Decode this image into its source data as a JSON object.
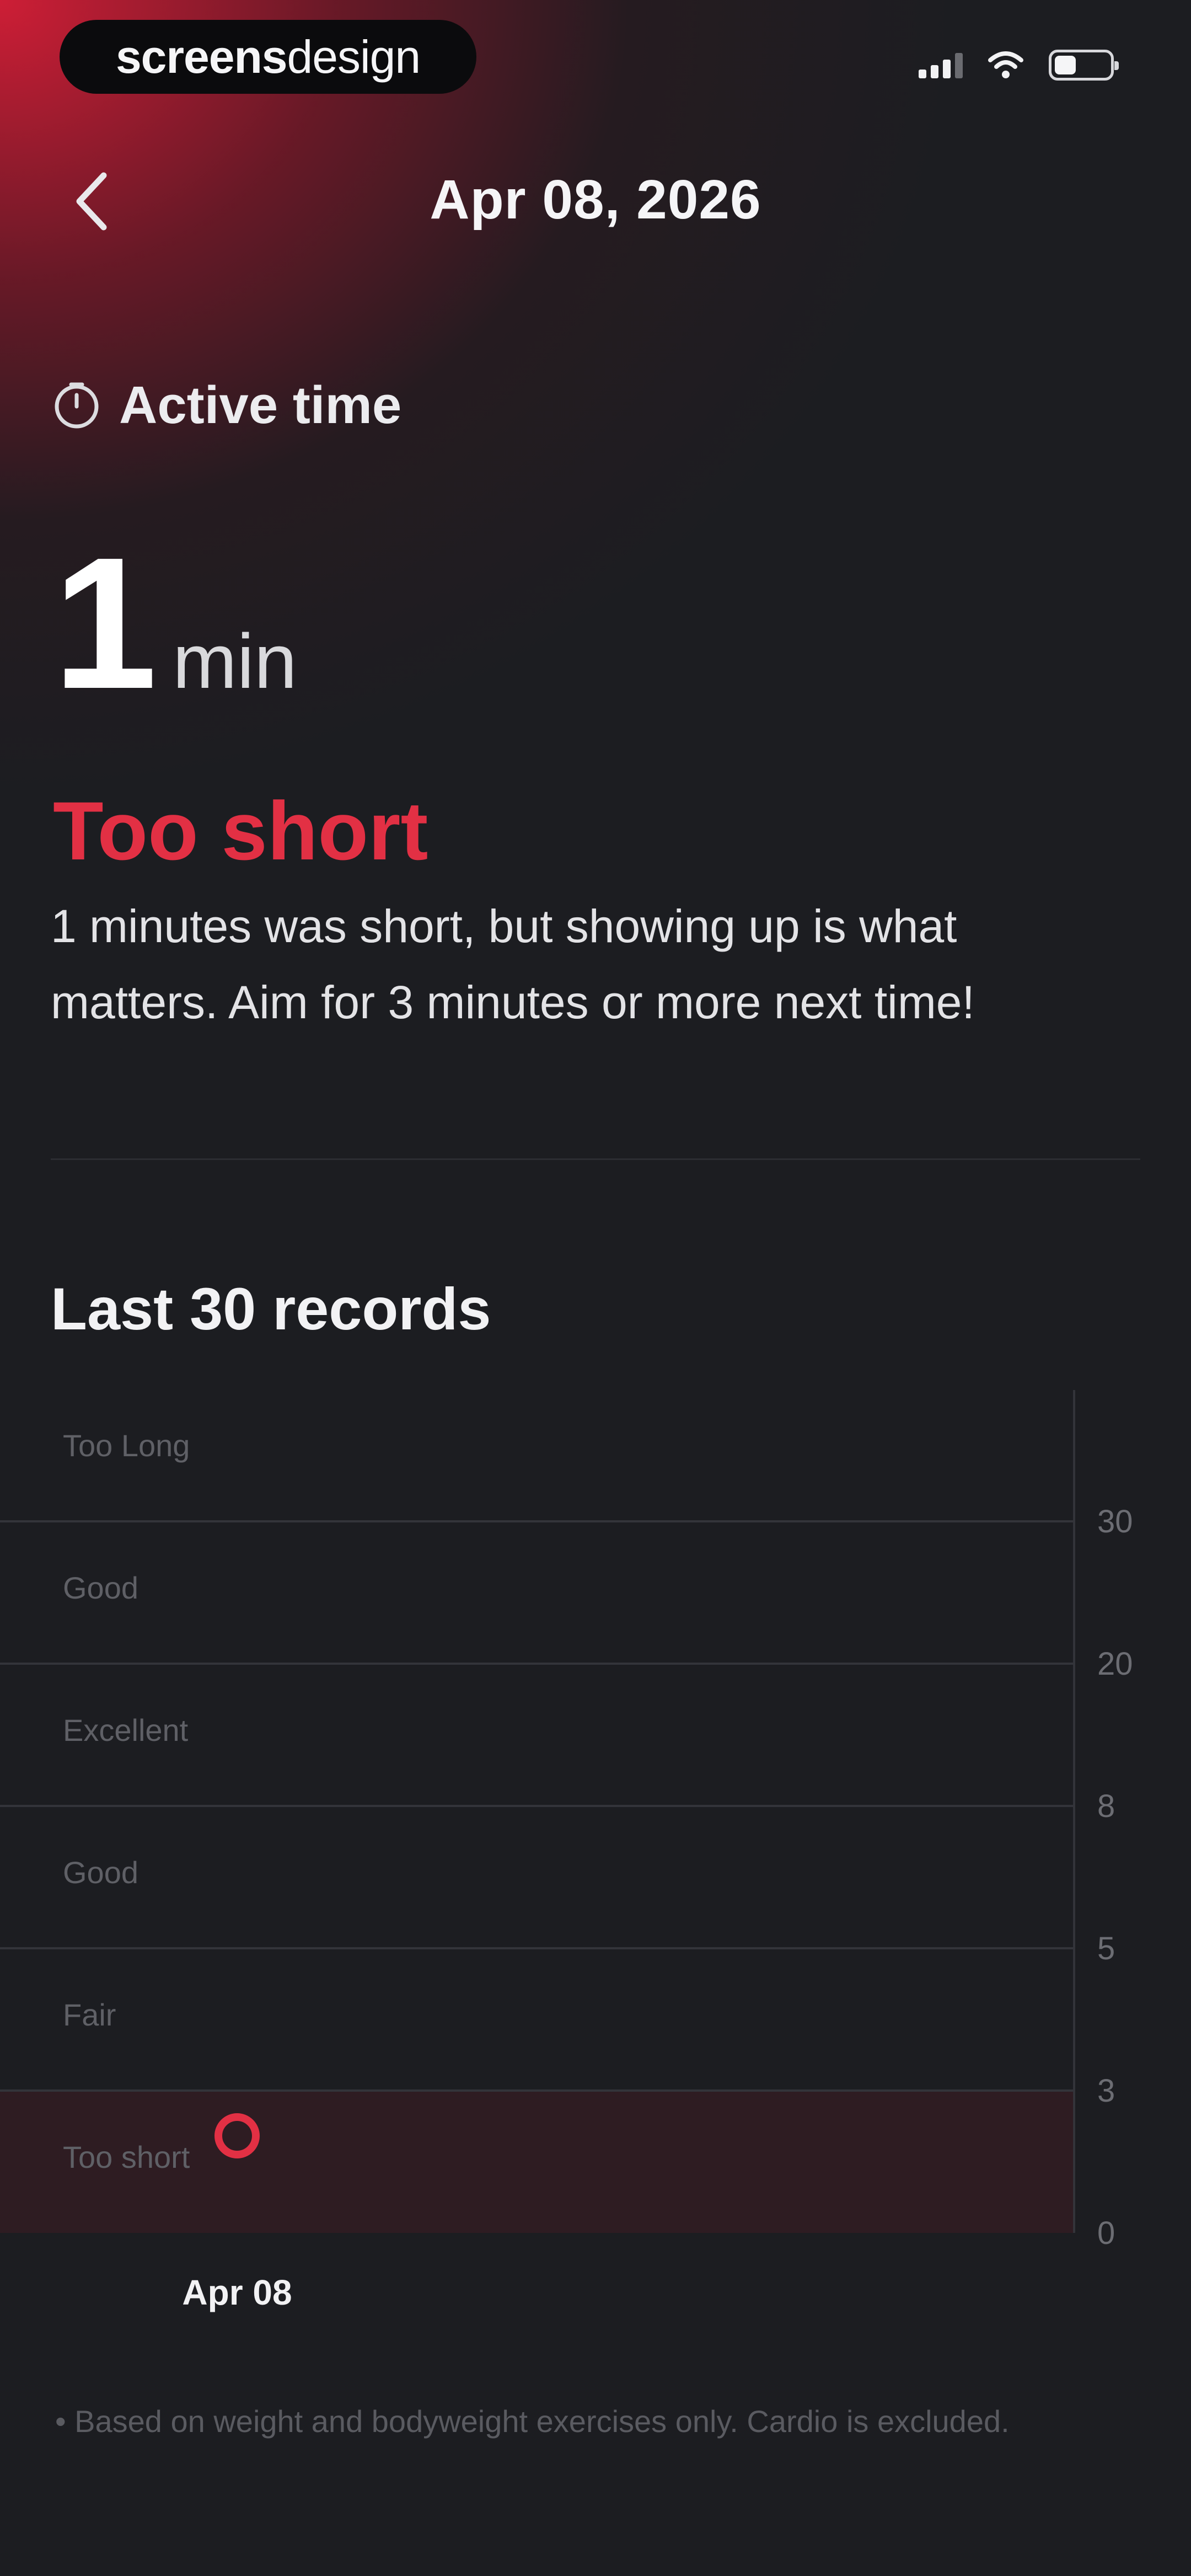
{
  "status_bar": {
    "brand_bold": "screens",
    "brand_light": "design"
  },
  "header": {
    "title": "Apr 08, 2026",
    "back_icon": "chevron-left-icon"
  },
  "metric": {
    "label": "Active time",
    "icon": "clock-icon",
    "value": "1",
    "unit": "min",
    "rating": "Too short",
    "message": "1 minutes was short, but showing up is what matters. Aim for 3 minutes or more next time!"
  },
  "section": {
    "title": "Last 30 records"
  },
  "chart_data": {
    "type": "scatter",
    "bands": [
      {
        "label": "Too Long",
        "from": 30,
        "to": null
      },
      {
        "label": "Good",
        "from": 20,
        "to": 30
      },
      {
        "label": "Excellent",
        "from": 8,
        "to": 20
      },
      {
        "label": "Good",
        "from": 5,
        "to": 8
      },
      {
        "label": "Fair",
        "from": 3,
        "to": 5
      },
      {
        "label": "Too short",
        "from": 0,
        "to": 3,
        "highlighted": true
      }
    ],
    "y_ticks": [
      "30",
      "20",
      "8",
      "5",
      "3",
      "0"
    ],
    "x": [
      "Apr 08"
    ],
    "values": [
      1
    ],
    "highlight_color": "#e23044",
    "grid": true
  },
  "footnote": "• Based on weight and bodyweight exercises only. Cardio is excluded.",
  "colors": {
    "accent": "#e23044",
    "background": "#1c1d21",
    "highlight_band": "#2e1c22"
  }
}
